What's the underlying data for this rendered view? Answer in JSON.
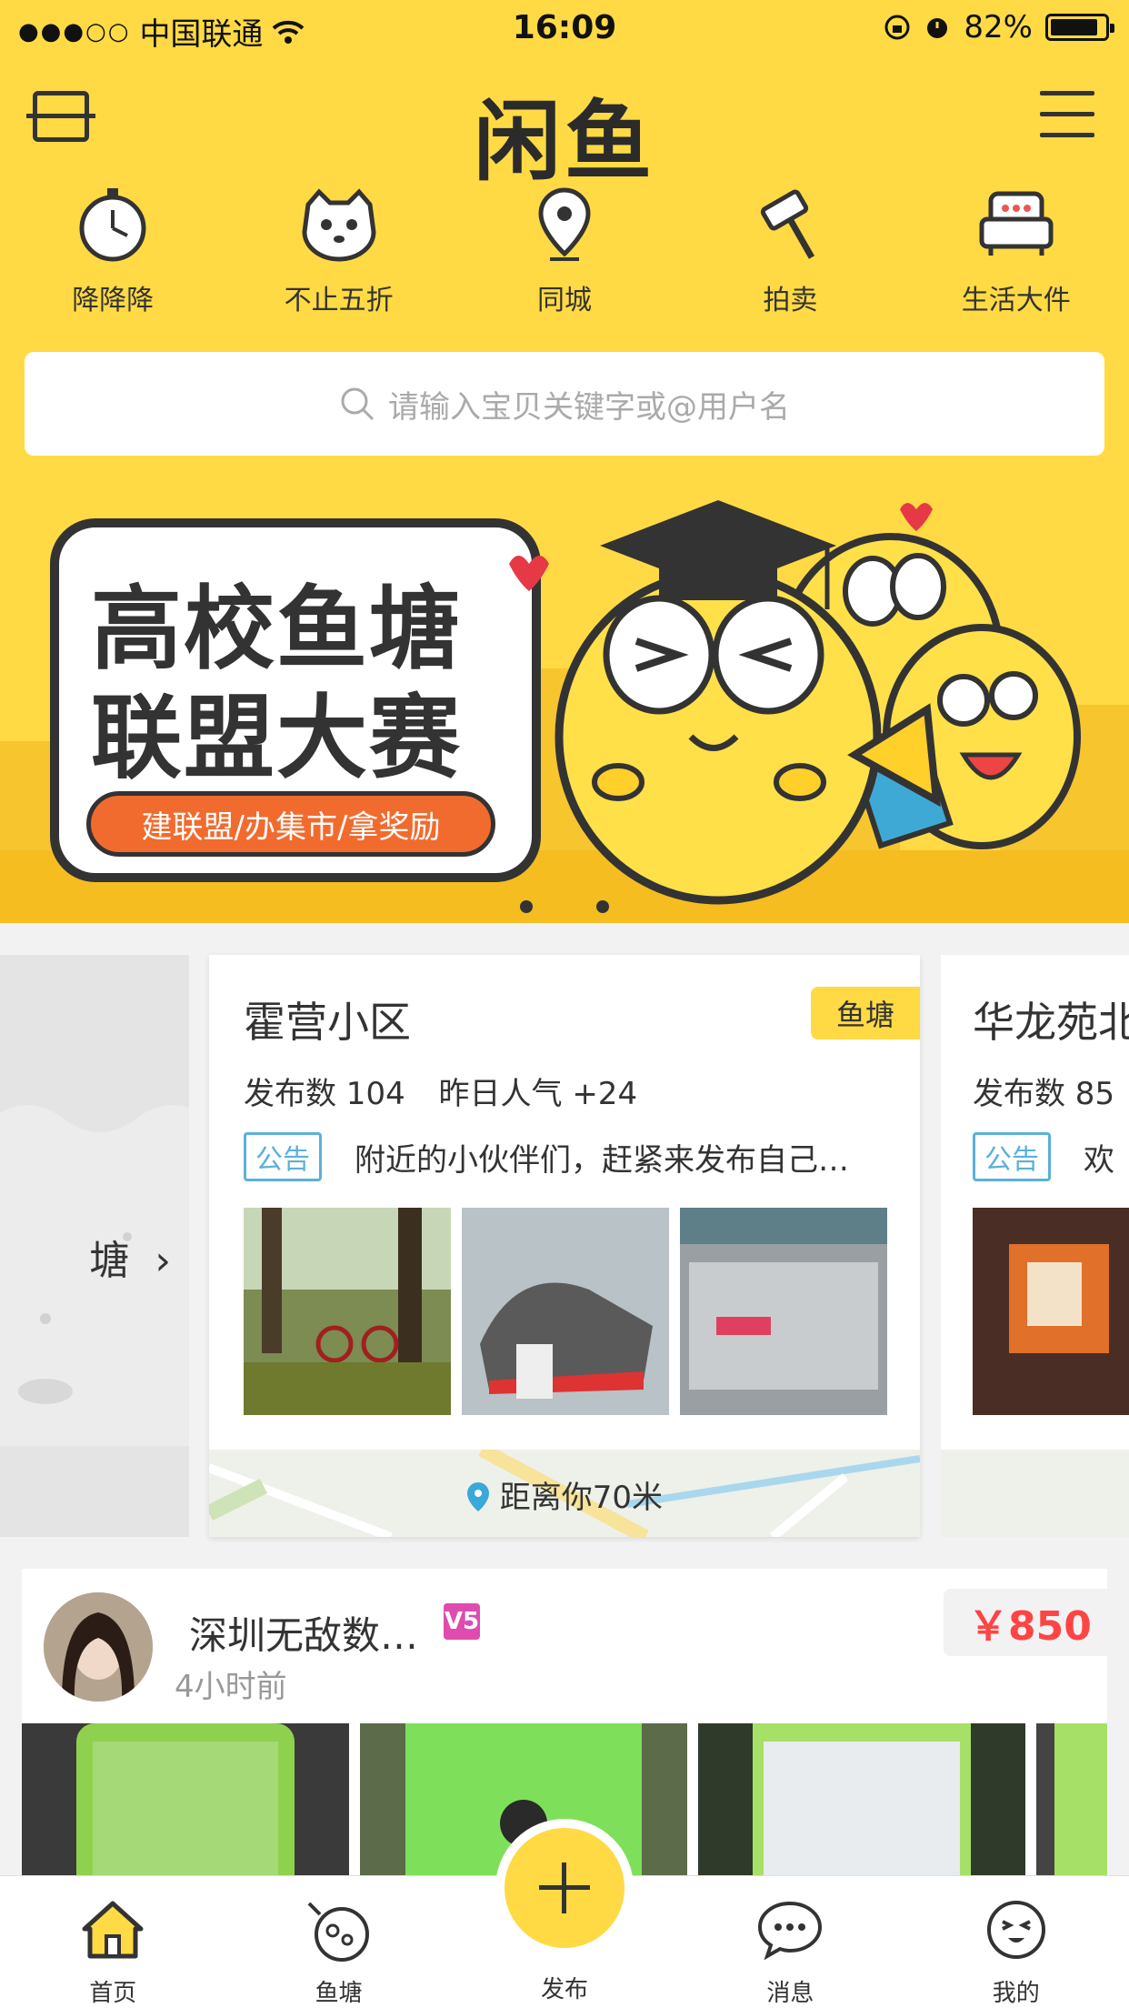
{
  "status_bar": {
    "signal": "●●●○○",
    "carrier": "中国联通",
    "time": "16:09",
    "battery": "82%"
  },
  "header": {
    "logo": "闲鱼"
  },
  "categories": [
    {
      "label": "降降降",
      "icon": "stopwatch-icon"
    },
    {
      "label": "不止五折",
      "icon": "cat-face-icon"
    },
    {
      "label": "同城",
      "icon": "location-pin-icon"
    },
    {
      "label": "拍卖",
      "icon": "auction-hammer-icon"
    },
    {
      "label": "生活大件",
      "icon": "sofa-icon"
    }
  ],
  "search": {
    "placeholder": "请输入宝贝关键字或@用户名"
  },
  "banner": {
    "title_line1": "高校鱼塘",
    "title_line2": "联盟大赛",
    "subtitle": "建联盟/办集市/拿奖励",
    "page_count": 2
  },
  "ponds": {
    "left_card_text": "塘",
    "main": {
      "name": "霍营小区",
      "tag": "鱼塘",
      "posts_label": "发布数 104",
      "popularity_label": "昨日人气 +24",
      "notice_badge": "公告",
      "notice_text": "附近的小伙伴们，赶紧来发布自己…",
      "distance": "距离你70米"
    },
    "right": {
      "name": "华龙苑北",
      "posts_label": "发布数 85",
      "notice_badge": "公告",
      "notice_text": "欢"
    }
  },
  "post": {
    "username": "深圳无敌数…",
    "vip_badge": "V5",
    "time_ago": "4小时前",
    "price": "￥850"
  },
  "tabbar": [
    {
      "label": "首页",
      "icon": "home-icon",
      "active": true
    },
    {
      "label": "鱼塘",
      "icon": "fish-pond-icon"
    },
    {
      "label": "发布",
      "icon": "plus-icon"
    },
    {
      "label": "消息",
      "icon": "chat-bubble-icon"
    },
    {
      "label": "我的",
      "icon": "face-icon"
    }
  ],
  "colors": {
    "brand_yellow": "#ffda44",
    "price_red": "#ff4444",
    "notice_blue": "#5ab1d9"
  }
}
